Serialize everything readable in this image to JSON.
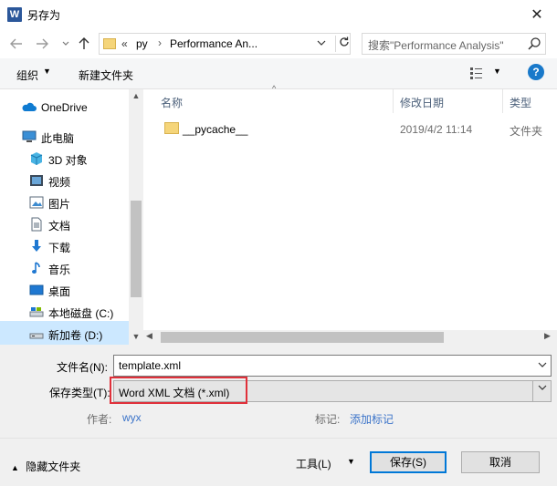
{
  "window": {
    "app_icon_letter": "W",
    "title": "另存为",
    "close_glyph": "✕"
  },
  "address_bar": {
    "overflow_chevrons": "«",
    "segments": [
      "py",
      "Performance An..."
    ],
    "separator": "›",
    "search_placeholder": "搜索\"Performance Analysis\""
  },
  "toolbar": {
    "organize_label": "组织",
    "new_folder_label": "新建文件夹"
  },
  "nav_pane": {
    "items": [
      {
        "label": "OneDrive",
        "icon": "cloud-icon"
      },
      {
        "label": "此电脑",
        "icon": "computer-icon"
      },
      {
        "label": "3D 对象",
        "icon": "cube-3d-icon"
      },
      {
        "label": "视频",
        "icon": "video-icon"
      },
      {
        "label": "图片",
        "icon": "picture-icon"
      },
      {
        "label": "文档",
        "icon": "document-icon"
      },
      {
        "label": "下载",
        "icon": "download-arrow-icon"
      },
      {
        "label": "音乐",
        "icon": "music-note-icon"
      },
      {
        "label": "桌面",
        "icon": "desktop-icon"
      },
      {
        "label": "本地磁盘 (C:)",
        "icon": "drive-c-icon"
      },
      {
        "label": "新加卷 (D:)",
        "icon": "drive-d-icon"
      }
    ],
    "selected": "新加卷 (D:)"
  },
  "file_list": {
    "columns": [
      "名称",
      "修改日期",
      "类型"
    ],
    "rows": [
      {
        "name": "__pycache__",
        "modified": "2019/4/2 11:14",
        "type": "文件夹"
      }
    ]
  },
  "form": {
    "filename_label": "文件名(N):",
    "filename_value": "template.xml",
    "savetype_label": "保存类型(T):",
    "savetype_value": "Word XML 文档 (*.xml)",
    "author_label": "作者:",
    "author_value": "wyx",
    "tags_label": "标记:",
    "tags_value": "添加标记"
  },
  "footer": {
    "hide_folders_label": "隐藏文件夹",
    "tools_label": "工具(L)",
    "save_label": "保存(S)",
    "cancel_label": "取消"
  },
  "colors": {
    "accent": "#0078d7",
    "highlight_border": "#e0303a",
    "link": "#3c74c9",
    "selection": "#cce8ff"
  }
}
